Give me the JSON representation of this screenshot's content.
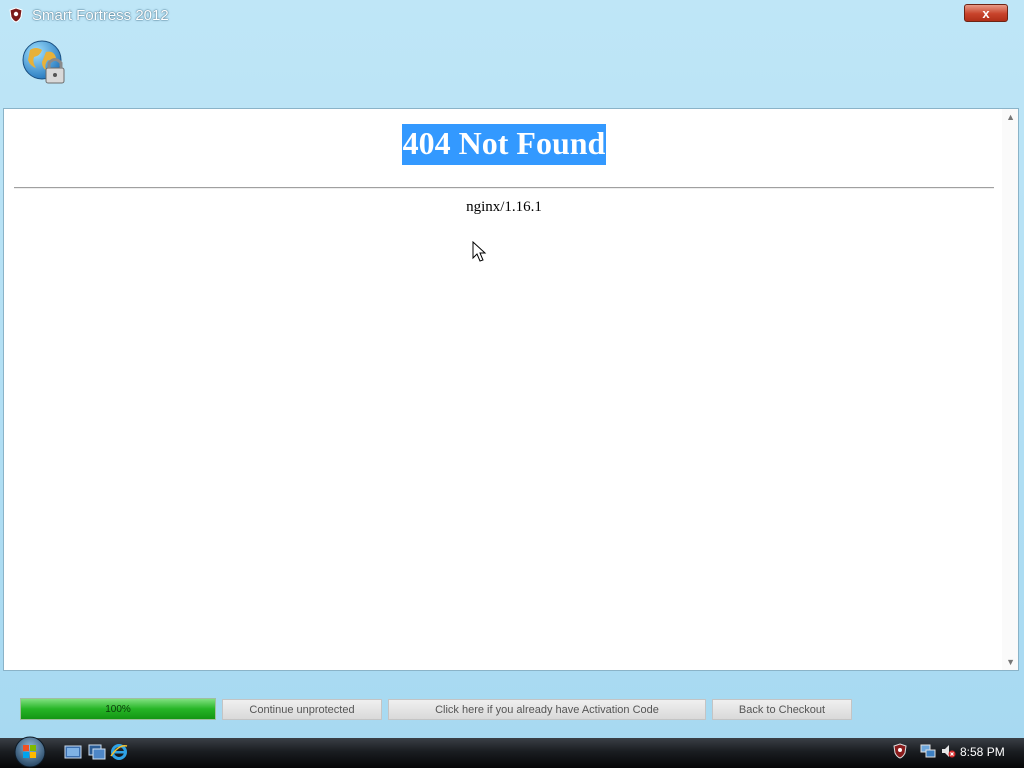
{
  "window": {
    "title": "Smart Fortress 2012",
    "title_icon": "shield-icon",
    "close_label": "x",
    "logo_icon": "globe-lock-icon"
  },
  "page": {
    "heading": "404 Not Found",
    "server": "nginx/1.16.1"
  },
  "bottom": {
    "progress_label": "100%",
    "progress_value": 1.0,
    "buttons": {
      "continue": "Continue unprotected",
      "activation": "Click here if you already have Activation Code",
      "checkout": "Back to Checkout"
    }
  },
  "taskbar": {
    "icons": [
      "start-orb-icon",
      "show-desktop-icon",
      "switch-windows-icon",
      "internet-explorer-icon"
    ],
    "tray_icons": [
      "shield-tray-icon",
      "network-icon",
      "volume-muted-icon"
    ],
    "clock": "8:58 PM"
  },
  "colors": {
    "selection": "#3399ff",
    "frame": "#a9dbf3",
    "progress": "#26b526"
  }
}
